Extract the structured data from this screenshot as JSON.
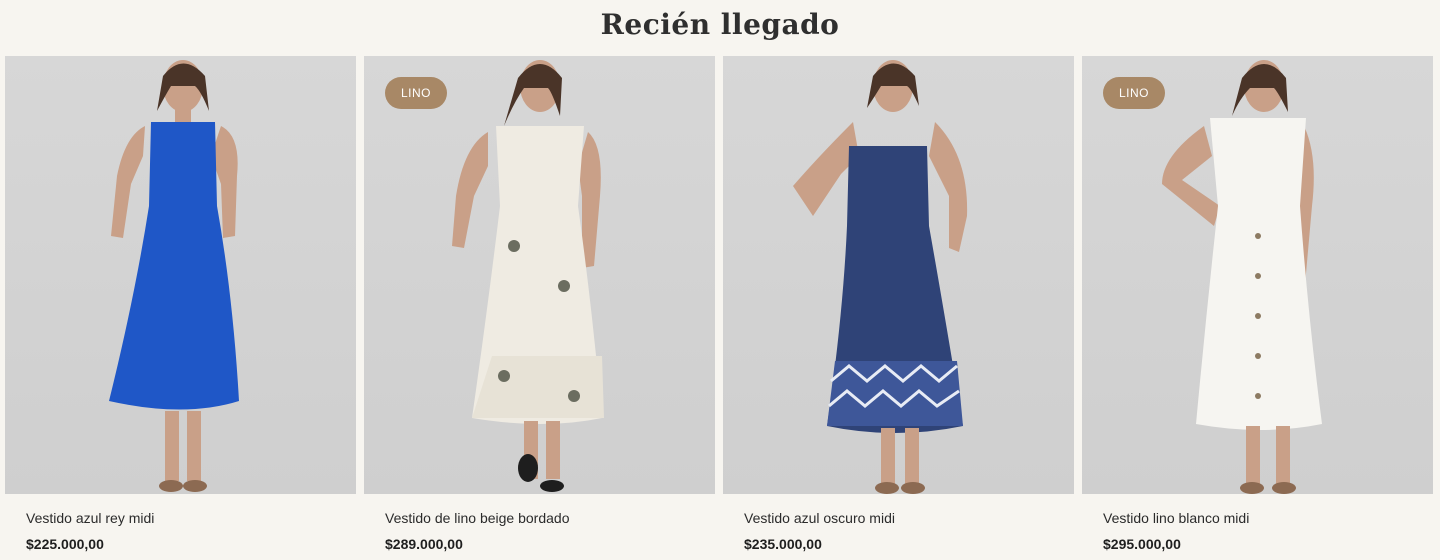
{
  "section": {
    "title": "Recién llegado"
  },
  "products": [
    {
      "name": "Vestido azul rey midi",
      "price": "$225.000,00",
      "badge": "",
      "dress_color": "#1f57c7"
    },
    {
      "name": "Vestido de lino beige bordado",
      "price": "$289.000,00",
      "badge": "LINO",
      "dress_color": "#efebe2"
    },
    {
      "name": "Vestido azul oscuro midi",
      "price": "$235.000,00",
      "badge": "",
      "dress_color": "#2f4377"
    },
    {
      "name": "Vestido lino blanco midi",
      "price": "$295.000,00",
      "badge": "LINO",
      "dress_color": "#f6f5f1"
    }
  ]
}
